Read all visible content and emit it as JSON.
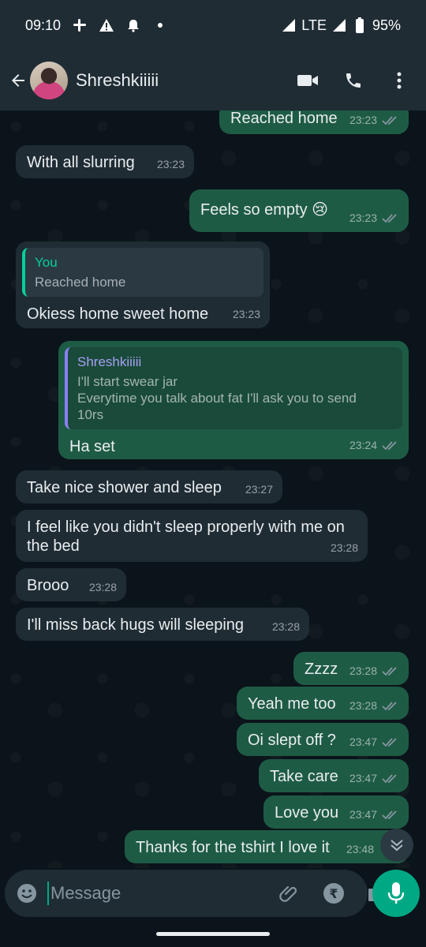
{
  "status": {
    "time": "09:10",
    "network": "LTE",
    "battery": "95%"
  },
  "header": {
    "contact_name": "Shreshkiiiii"
  },
  "messages": [
    {
      "dir": "out",
      "text": "Reached home",
      "time": "23:23"
    },
    {
      "dir": "in",
      "text": "With all slurring",
      "time": "23:23"
    },
    {
      "dir": "out",
      "text": "Feels so empty 😢",
      "time": "23:23"
    },
    {
      "dir": "in",
      "text": "Okiess home sweet home",
      "time": "23:23",
      "quote": {
        "name": "You",
        "text": "Reached home"
      }
    },
    {
      "dir": "out",
      "text": "Ha set",
      "time": "23:24",
      "quote": {
        "name": "Shreshkiiiii",
        "text_lines": [
          "I'll start swear jar",
          "Everytime you talk about fat I'll ask you to send",
          "10rs"
        ]
      }
    },
    {
      "dir": "in",
      "text": "Take nice shower and sleep",
      "time": "23:27"
    },
    {
      "dir": "in",
      "text_lines": [
        "I feel like you didn't sleep properly with me on",
        "the bed"
      ],
      "time": "23:28"
    },
    {
      "dir": "in",
      "text": "Brooo",
      "time": "23:28"
    },
    {
      "dir": "in",
      "text": "I'll miss back hugs will sleeping",
      "time": "23:28"
    },
    {
      "dir": "out",
      "text": "Zzzz",
      "time": "23:28"
    },
    {
      "dir": "out",
      "text": "Yeah me too",
      "time": "23:28"
    },
    {
      "dir": "out",
      "text": "Oi slept off ?",
      "time": "23:47"
    },
    {
      "dir": "out",
      "text": "Take care",
      "time": "23:47"
    },
    {
      "dir": "out",
      "text": "Love you",
      "time": "23:47"
    },
    {
      "dir": "out",
      "text": "Thanks for the tshirt I love it",
      "time": "23:48"
    }
  ],
  "input": {
    "placeholder": "Message"
  },
  "colors": {
    "incoming": "#1f2c34",
    "outgoing": "#1e5b45",
    "accent": "#00a884"
  }
}
